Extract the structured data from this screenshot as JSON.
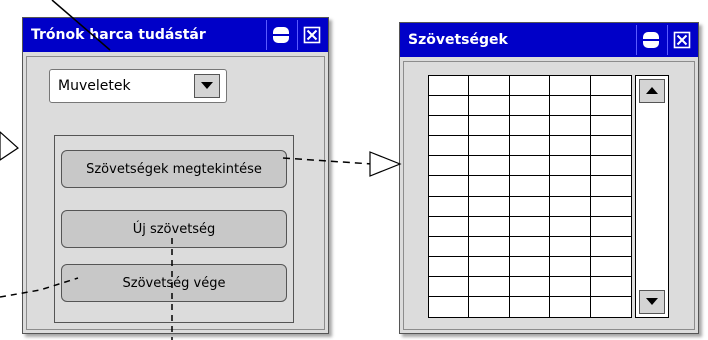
{
  "left_window": {
    "title": "Trónok harca tudástár",
    "dropdown_value": "Muveletek",
    "buttons": [
      "Szövetségek megtekintése",
      "Új szövetség",
      "Szövetség vége"
    ]
  },
  "right_window": {
    "title": "Szövetségek"
  },
  "colors": {
    "titlebar": "#0000c8",
    "window_bg": "#dcdcdc",
    "button_bg": "#c8c8c8"
  },
  "icons": [
    "minimize-icon",
    "close-icon",
    "dropdown-arrow-icon",
    "scroll-up-icon",
    "scroll-down-icon",
    "arrowhead-icon"
  ]
}
